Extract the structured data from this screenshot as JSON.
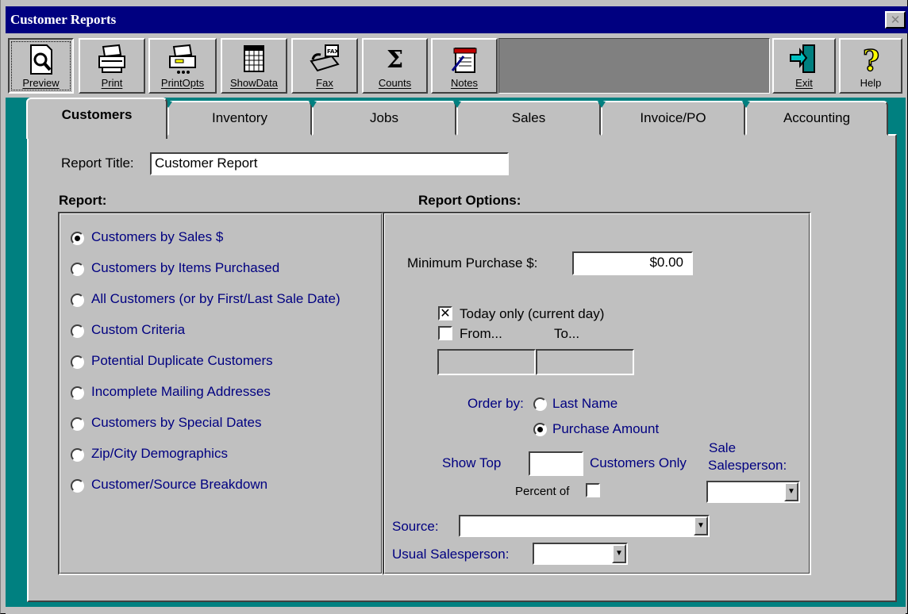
{
  "window": {
    "title": "Customer Reports",
    "close_glyph": "✕"
  },
  "toolbar": {
    "buttons": [
      {
        "label": "Preview",
        "icon": "preview-icon"
      },
      {
        "label": "Print",
        "icon": "printer-icon"
      },
      {
        "label": "PrintOpts",
        "icon": "print-options-icon"
      },
      {
        "label": "ShowData",
        "icon": "grid-icon"
      },
      {
        "label": "Fax",
        "icon": "fax-icon"
      },
      {
        "label": "Counts",
        "icon": "sigma-icon"
      },
      {
        "label": "Notes",
        "icon": "notes-icon"
      },
      {
        "label": "Exit",
        "icon": "exit-door-icon"
      },
      {
        "label": "Help",
        "icon": "help-icon"
      }
    ]
  },
  "tabs": [
    "Customers",
    "Inventory",
    "Jobs",
    "Sales",
    "Invoice/PO",
    "Accounting"
  ],
  "report_title": {
    "label": "Report Title:",
    "value": "Customer Report"
  },
  "report": {
    "heading": "Report:",
    "options": [
      "Customers by Sales $",
      "Customers by Items Purchased",
      "All Customers (or by First/Last Sale Date)",
      "Custom Criteria",
      "Potential Duplicate Customers",
      "Incomplete Mailing Addresses",
      "Customers by Special Dates",
      "Zip/City Demographics",
      "Customer/Source Breakdown"
    ],
    "selected_index": 0
  },
  "report_options": {
    "heading": "Report Options:",
    "min_purchase_label": "Minimum Purchase $:",
    "min_purchase_value": "$0.00",
    "today_only_label": "Today only (current day)",
    "today_only_checked": true,
    "today_check_glyph": "✕",
    "from_label": "From...",
    "to_label": "To...",
    "order_by_label": "Order by:",
    "order_last_name": "Last Name",
    "order_purchase_amount": "Purchase Amount",
    "order_selected": "Purchase Amount",
    "show_top_label": "Show Top",
    "customers_only_label": "Customers Only",
    "percent_of_label": "Percent of",
    "sale_label": "Sale",
    "salesperson_label": "Salesperson:",
    "source_label": "Source:",
    "usual_salesperson_label": "Usual Salesperson:",
    "dropdown_glyph": "▼"
  }
}
